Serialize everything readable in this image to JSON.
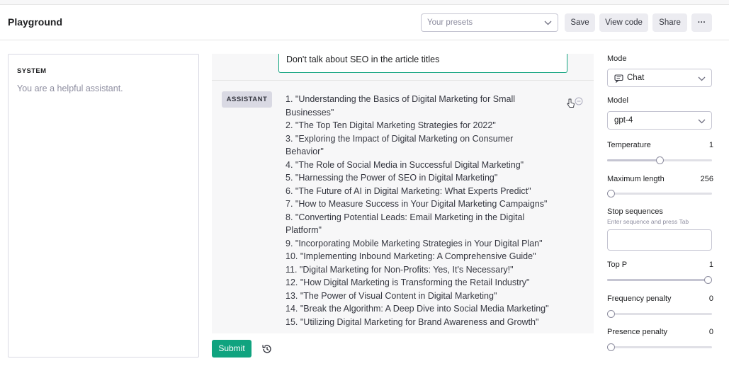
{
  "header": {
    "title": "Playground",
    "presets_placeholder": "Your presets",
    "save_label": "Save",
    "view_code_label": "View code",
    "share_label": "Share",
    "more_label": "···"
  },
  "system": {
    "label": "SYSTEM",
    "text": "You are a helpful assistant."
  },
  "chat": {
    "user_message": "Don't talk about SEO in the article titles",
    "assistant_role": "ASSISTANT",
    "assistant_lines": [
      "1. \"Understanding the Basics of Digital Marketing for Small",
      "Businesses\"",
      "2. \"The Top Ten Digital Marketing Strategies for 2022\"",
      "3. \"Exploring the Impact of Digital Marketing on Consumer",
      "Behavior\"",
      "4. \"The Role of Social Media in Successful Digital Marketing\"",
      "5. \"Harnessing the Power of SEO in Digital Marketing\"",
      "6. \"The Future of AI in Digital Marketing: What Experts Predict\"",
      "7. \"How to Measure Success in Your Digital Marketing Campaigns\"",
      "8. \"Converting Potential Leads: Email Marketing in the Digital",
      "Platform\"",
      "9. \"Incorporating Mobile Marketing Strategies in Your Digital Plan\"",
      "10. \"Implementing Inbound Marketing: A Comprehensive Guide\"",
      "11. \"Digital Marketing for Non-Profits: Yes, It's Necessary!\"",
      "12. \"How Digital Marketing is Transforming the Retail Industry\"",
      "13. \"The Power of Visual Content in Digital Marketing\"",
      "14. \"Break the Algorithm: A Deep Dive into Social Media Marketing\"",
      "15. \"Utilizing Digital Marketing for Brand Awareness and Growth\""
    ],
    "submit_label": "Submit"
  },
  "settings": {
    "mode_label": "Mode",
    "mode_value": "Chat",
    "model_label": "Model",
    "model_value": "gpt-4",
    "temperature_label": "Temperature",
    "temperature_value": "1",
    "temperature_fraction": 0.5,
    "max_length_label": "Maximum length",
    "max_length_value": "256",
    "max_length_fraction": 0.03,
    "stop_sequences_label": "Stop sequences",
    "stop_sequences_hint": "Enter sequence and press Tab",
    "top_p_label": "Top P",
    "top_p_value": "1",
    "top_p_fraction": 1.0,
    "frequency_penalty_label": "Frequency penalty",
    "frequency_penalty_value": "0",
    "frequency_penalty_fraction": 0.0,
    "presence_penalty_label": "Presence penalty",
    "presence_penalty_value": "0",
    "presence_penalty_fraction": 0.0
  },
  "icons": {
    "presets_chevron": "chevron-down-icon",
    "mode_icon": "chat-bubble-icon",
    "history": "history-icon",
    "remove": "minus-circle-icon",
    "cursor": "hand-pointer-icon"
  },
  "colors": {
    "accent": "#10a37f",
    "button_bg": "#ececf1",
    "badge_bg": "#d9d9e3",
    "chat_bg": "#f7f7f8"
  }
}
